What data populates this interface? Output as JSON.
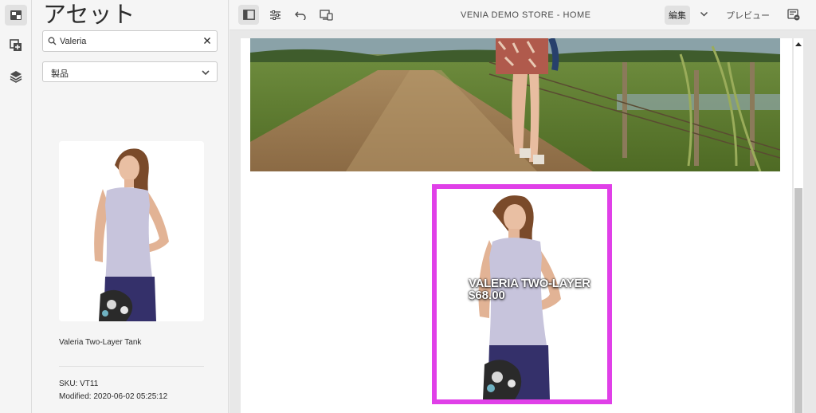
{
  "panel": {
    "title": "アセット",
    "search": {
      "value": "Valeria",
      "placeholder": ""
    },
    "filter": {
      "selected": "製品"
    },
    "asset": {
      "name": "Valeria Two-Layer Tank",
      "sku": "SKU: VT11",
      "modified": "Modified: 2020-06-02 05:25:12"
    }
  },
  "toolbar": {
    "page_name": "VENIA DEMO STORE - HOME",
    "mode_label": "編集",
    "preview_label": "プレビュー"
  },
  "product_teaser": {
    "title": "VALERIA TWO-LAYER",
    "price": "$68.00",
    "highlight_color": "#e040e8"
  }
}
